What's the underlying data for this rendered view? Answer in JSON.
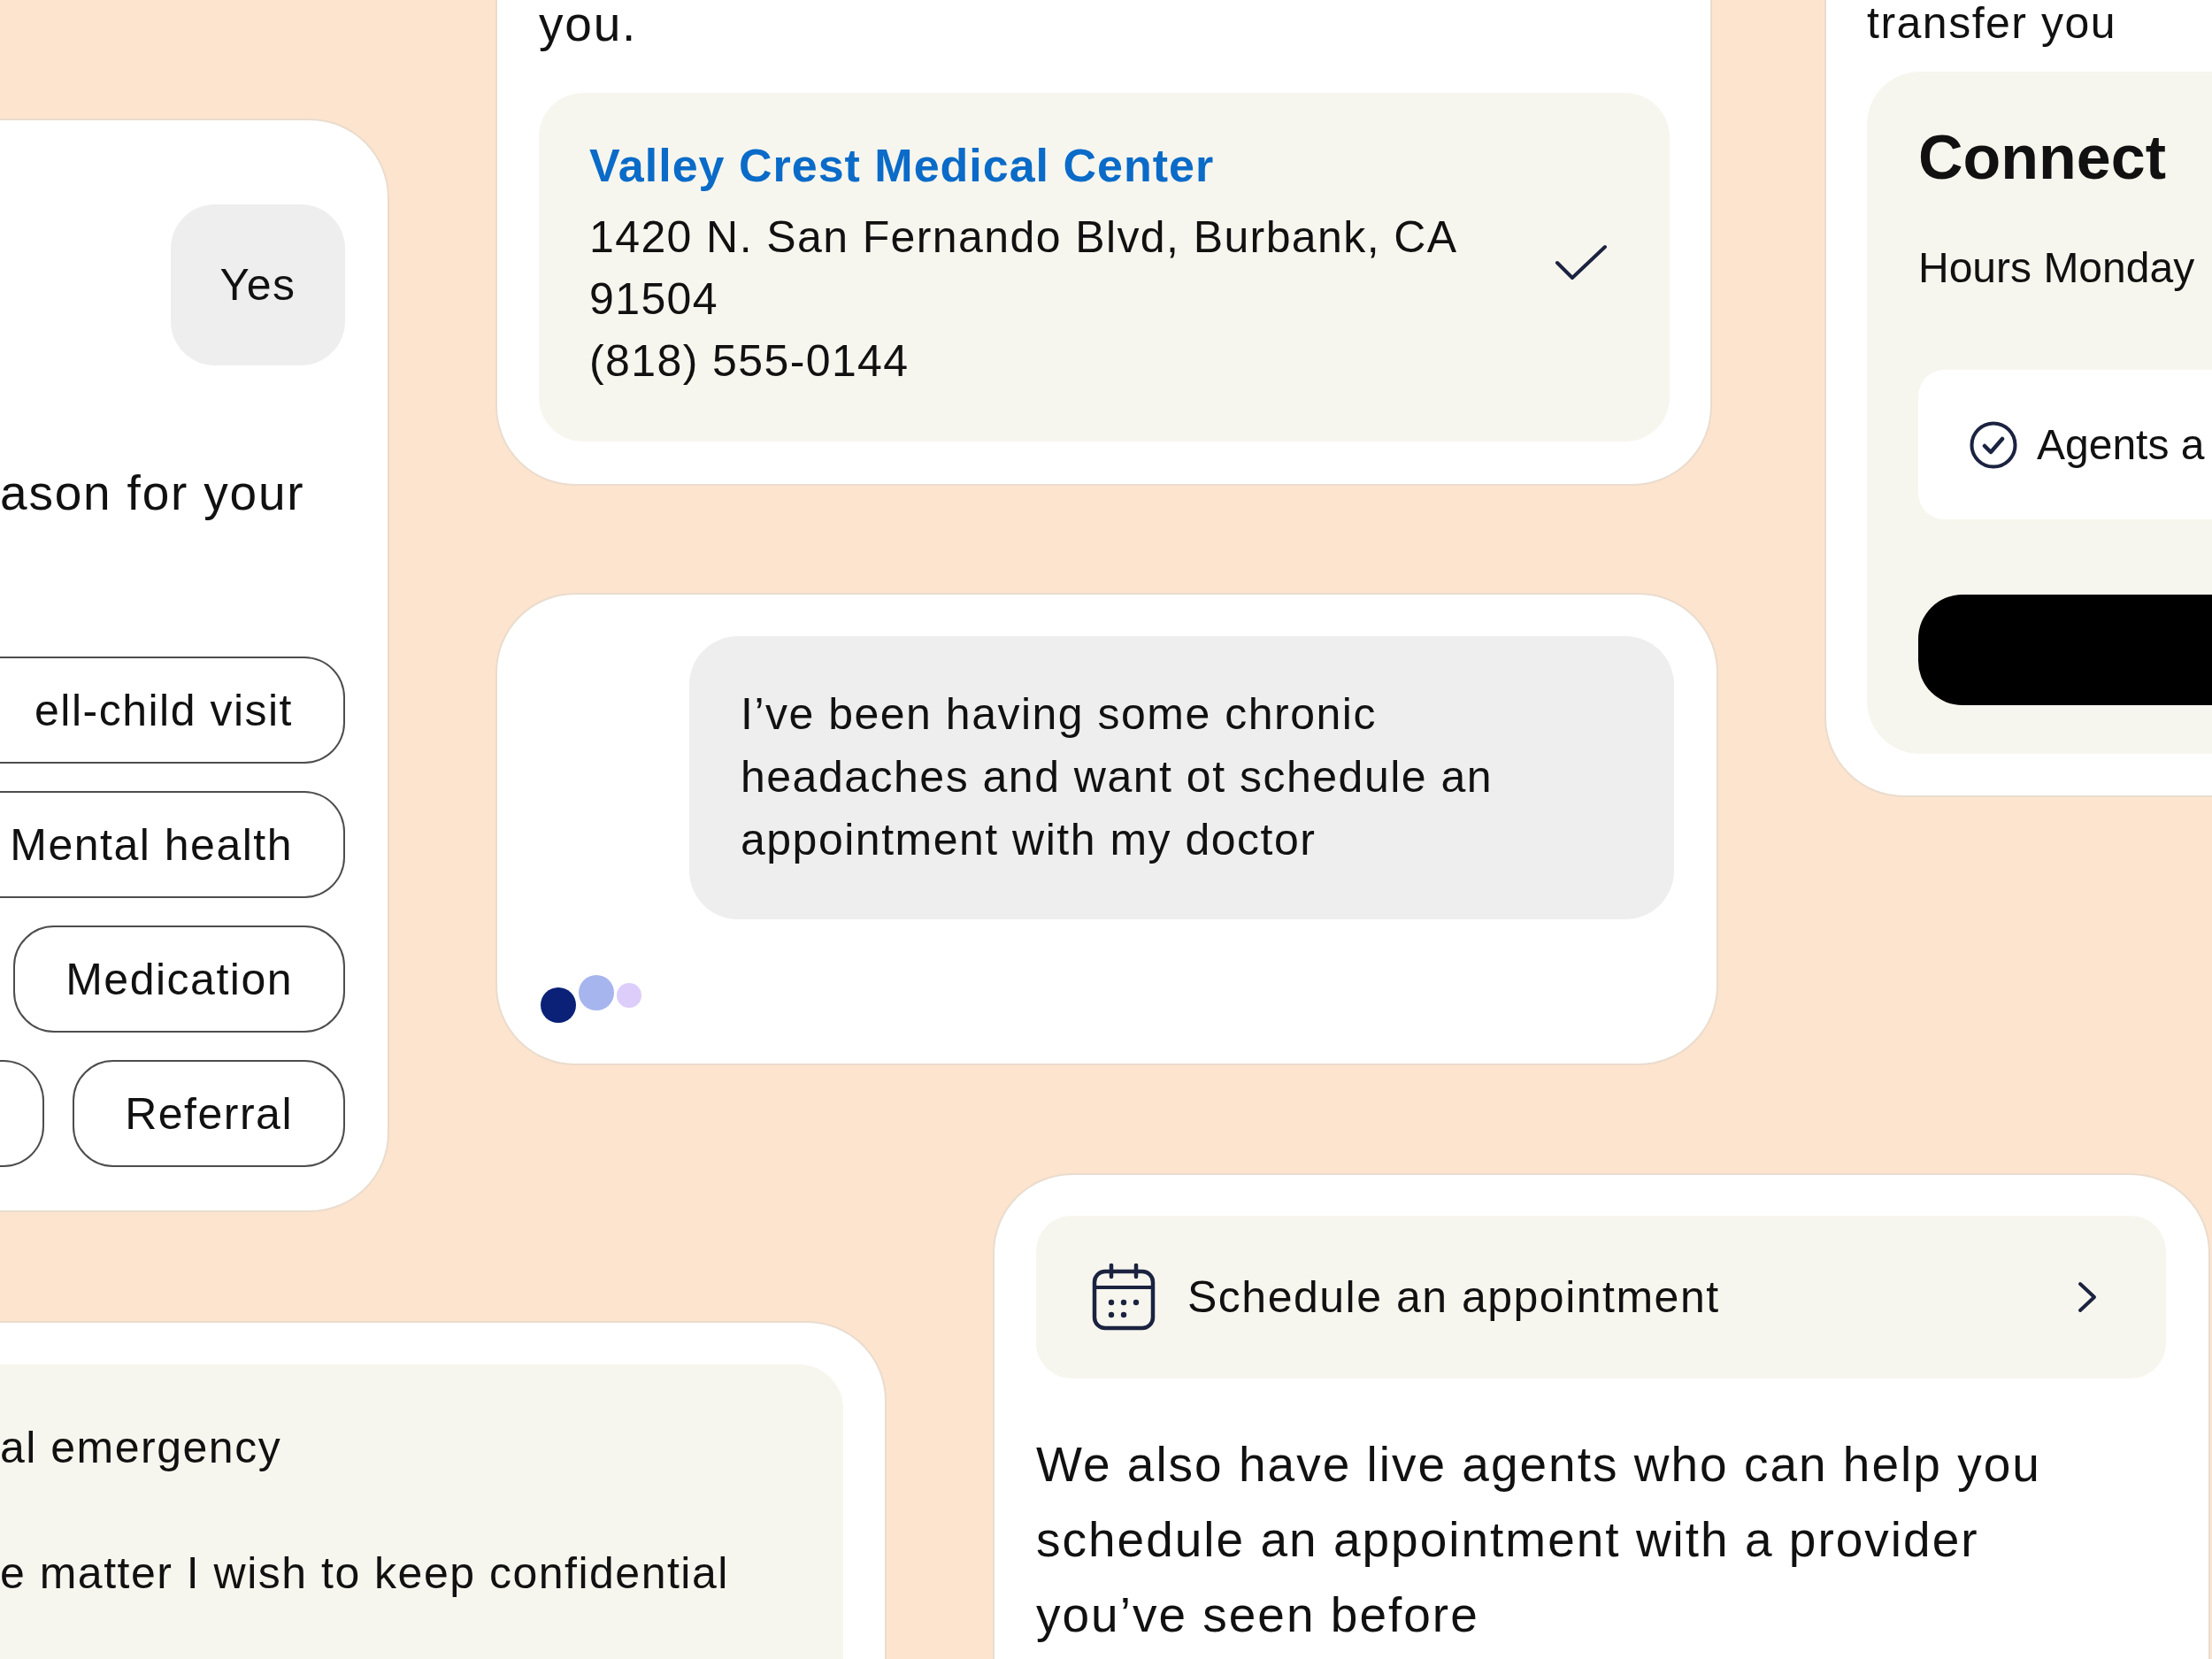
{
  "reason_card": {
    "reply": "Yes",
    "question": "ason for your",
    "option_rows": [
      [
        {
          "kind": "cut",
          "label": "ell-child visit"
        }
      ],
      [
        {
          "kind": "cut",
          "label": "Mental health"
        }
      ],
      [
        {
          "kind": "full",
          "label": "Medication"
        }
      ],
      [
        {
          "kind": "stub"
        },
        {
          "kind": "full",
          "label": "Referral"
        }
      ]
    ]
  },
  "location_card": {
    "intro": "you.",
    "location": {
      "name": "Valley Crest Medical Center",
      "address": "1420 N. San Fernando Blvd, Burbank, CA 91504",
      "phone": "(818) 555-0144",
      "selected": true
    }
  },
  "agent_card": {
    "intro": "transfer you",
    "title": "Connect",
    "hours": "Hours Monday",
    "status": "Agents a"
  },
  "chat_card": {
    "message": "I’ve been having some chronic headaches and want ot schedule an appointment with my doctor",
    "typing": true
  },
  "options_card": {
    "options": [
      "al emergency",
      "e matter I wish to keep confidential"
    ]
  },
  "schedule_card": {
    "action": {
      "label": "Schedule an appointment"
    },
    "message": "We also have live agents who can help you schedule an appointment with a provider you’ve seen before"
  }
}
